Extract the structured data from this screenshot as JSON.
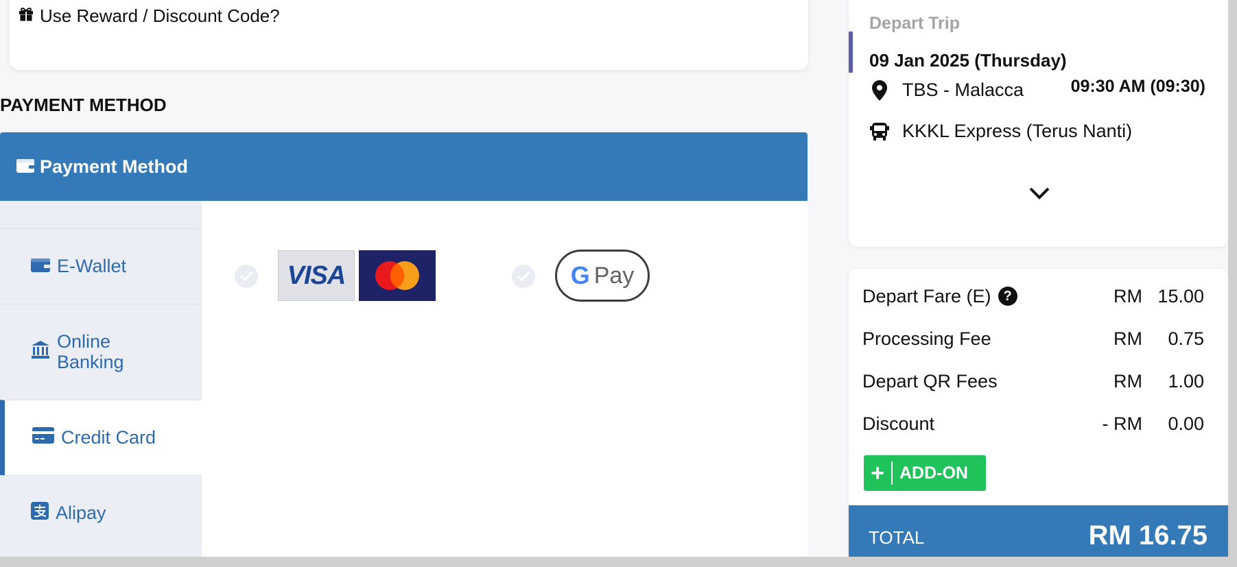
{
  "reward": {
    "label": "Use Reward / Discount Code?",
    "icon": "gift-icon"
  },
  "section_title": "PAYMENT METHOD",
  "payment_panel": {
    "header": "Payment Method",
    "tabs": [
      {
        "label": "E-Wallet",
        "icon": "wallet-icon"
      },
      {
        "label_line1": "Online",
        "label_line2": "Banking",
        "icon": "bank-icon"
      },
      {
        "label": "Credit Card",
        "icon": "credit-card-icon",
        "active": true
      },
      {
        "label": "Alipay",
        "icon": "alipay-icon"
      }
    ],
    "options": [
      {
        "name": "visa-mastercard",
        "visa_text": "VISA",
        "mastercard_text": "MasterCard"
      },
      {
        "name": "google-pay",
        "g_text": "G",
        "pay_text": "Pay"
      }
    ]
  },
  "trip": {
    "label": "Depart Trip",
    "date": "09 Jan 2025 (Thursday)",
    "origin": "TBS - Malacca",
    "time": "09:30 AM (09:30)",
    "operator": "KKKL Express (Terus Nanti)"
  },
  "fares": [
    {
      "label": "Depart Fare (E)",
      "currency": "RM",
      "amount": "15.00",
      "help": "?"
    },
    {
      "label": "Processing Fee",
      "currency": "RM",
      "amount": "0.75"
    },
    {
      "label": "Depart QR Fees",
      "currency": "RM",
      "amount": "1.00"
    },
    {
      "label": "Discount",
      "currency": "- RM",
      "amount": "0.00"
    }
  ],
  "addon": {
    "plus": "+",
    "label": "ADD-ON"
  },
  "total": {
    "label": "TOTAL",
    "value": "RM 16.75"
  },
  "colors": {
    "primary": "#3479b8",
    "addon": "#20c25a",
    "tab_text": "#2d6aae"
  }
}
